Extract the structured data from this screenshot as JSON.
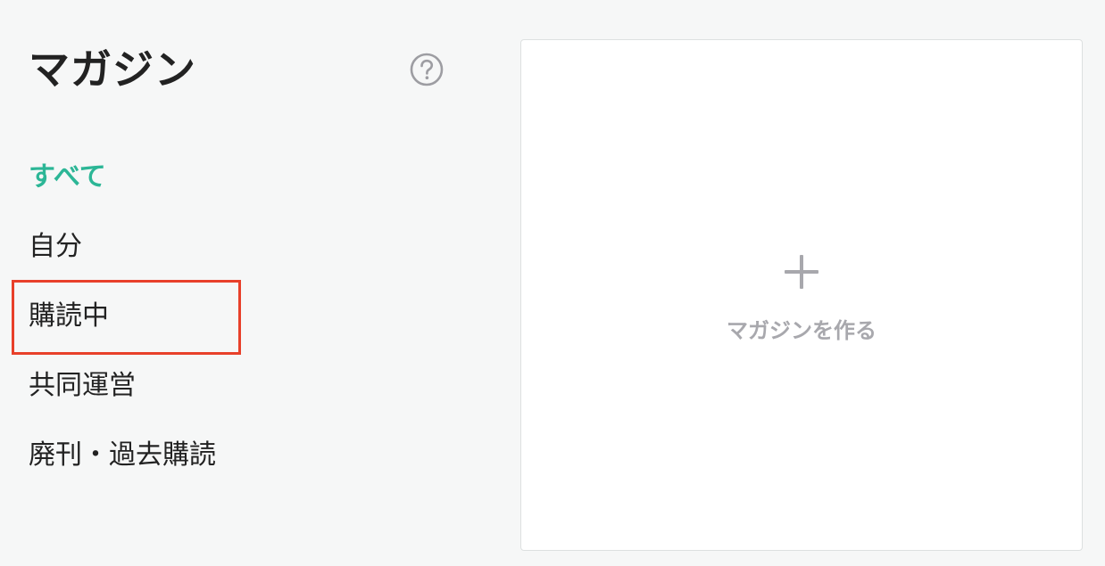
{
  "header": {
    "title": "マガジン",
    "help_icon": "question-circle-icon"
  },
  "nav": {
    "items": [
      {
        "label": "すべて",
        "active": true
      },
      {
        "label": "自分",
        "active": false
      },
      {
        "label": "購読中",
        "active": false,
        "highlighted": true
      },
      {
        "label": "共同運営",
        "active": false
      },
      {
        "label": "廃刊・過去購読",
        "active": false
      }
    ]
  },
  "create_card": {
    "icon": "plus-icon",
    "label": "マガジンを作る"
  },
  "colors": {
    "accent": "#2cb696",
    "highlight": "#e8402a",
    "muted": "#a8a8ad",
    "text": "#222222",
    "background": "#f6f7f7"
  }
}
